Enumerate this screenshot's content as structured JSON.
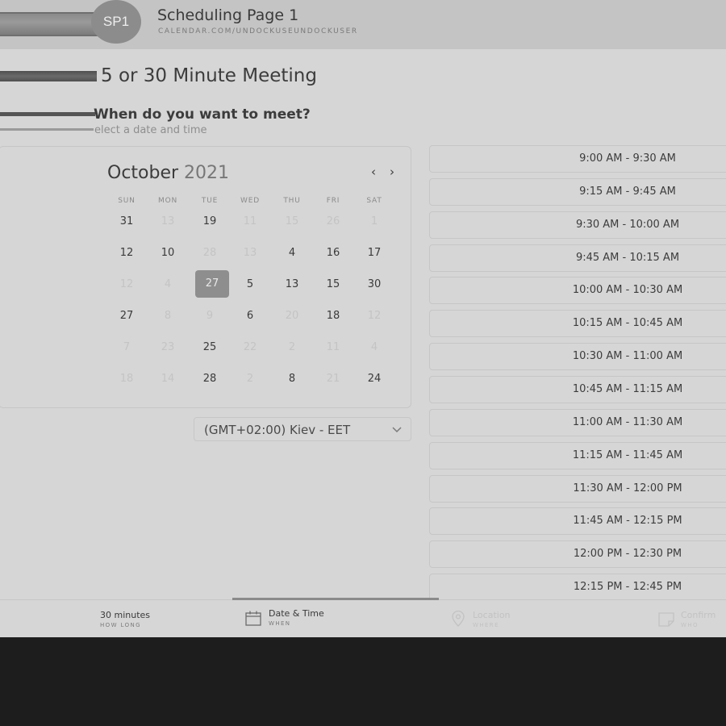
{
  "header": {
    "avatar_initials": "SP1",
    "title": "Scheduling Page 1",
    "url": "CALENDAR.COM/UNDOCKUSEUNDOCKUSER"
  },
  "meeting": {
    "title": "5 or 30 Minute Meeting",
    "question": "When do you want to meet?",
    "subtitle": "elect a date and time"
  },
  "calendar": {
    "month": "October",
    "year": "2021",
    "prev_icon": "chevron-left-icon",
    "next_icon": "chevron-right-icon",
    "weekdays": [
      "SUN",
      "MON",
      "TUE",
      "WED",
      "THU",
      "FRI",
      "SAT"
    ],
    "selected_day": "27",
    "rows": [
      [
        [
          "31",
          true
        ],
        [
          "13",
          false
        ],
        [
          "19",
          true
        ],
        [
          "11",
          false
        ],
        [
          "15",
          false
        ],
        [
          "26",
          false
        ],
        [
          "1",
          false
        ]
      ],
      [
        [
          "12",
          true
        ],
        [
          "10",
          true
        ],
        [
          "28",
          false
        ],
        [
          "13",
          false
        ],
        [
          "4",
          true
        ],
        [
          "16",
          true
        ],
        [
          "17",
          true
        ]
      ],
      [
        [
          "12",
          false
        ],
        [
          "4",
          false
        ],
        [
          "27",
          true
        ],
        [
          "5",
          true
        ],
        [
          "13",
          true
        ],
        [
          "15",
          true
        ],
        [
          "30",
          true
        ]
      ],
      [
        [
          "27",
          true
        ],
        [
          "8",
          false
        ],
        [
          "9",
          false
        ],
        [
          "6",
          true
        ],
        [
          "20",
          false
        ],
        [
          "18",
          true
        ],
        [
          "12",
          false
        ]
      ],
      [
        [
          "7",
          false
        ],
        [
          "23",
          false
        ],
        [
          "25",
          true
        ],
        [
          "22",
          false
        ],
        [
          "2",
          false
        ],
        [
          "11",
          false
        ],
        [
          "4",
          false
        ]
      ],
      [
        [
          "18",
          false
        ],
        [
          "14",
          false
        ],
        [
          "28",
          true
        ],
        [
          "2",
          false
        ],
        [
          "8",
          true
        ],
        [
          "21",
          false
        ],
        [
          "24",
          true
        ]
      ]
    ]
  },
  "timezone": {
    "value": "(GMT+02:00) Kiev - EET",
    "icon": "chevron-down-icon"
  },
  "time_slots": [
    "9:00 AM - 9:30 AM",
    "9:15 AM - 9:45 AM",
    "9:30 AM - 10:00 AM",
    "9:45 AM - 10:15 AM",
    "10:00 AM - 10:30 AM",
    "10:15 AM - 10:45 AM",
    "10:30 AM - 11:00 AM",
    "10:45 AM - 11:15 AM",
    "11:00 AM - 11:30 AM",
    "11:15 AM - 11:45 AM",
    "11:30 AM - 12:00 PM",
    "11:45 AM - 12:15 PM",
    "12:00 PM - 12:30 PM",
    "12:15 PM - 12:45 PM"
  ],
  "steps": [
    {
      "label": "30 minutes",
      "sub": "HOW LONG",
      "icon": "",
      "active": true
    },
    {
      "label": "Date & Time",
      "sub": "WHEN",
      "icon": "calendar-icon",
      "active": true
    },
    {
      "label": "Location",
      "sub": "WHERE",
      "icon": "location-pin-icon",
      "active": false
    },
    {
      "label": "Confirm",
      "sub": "WHO",
      "icon": "confirm-note-icon",
      "active": false
    }
  ],
  "colors": {
    "page_bg": "#d6d6d6",
    "header_bg": "#c4c4c4",
    "selected_day_bg": "#8e8e8e",
    "outer_bg": "#1d1d1d"
  }
}
